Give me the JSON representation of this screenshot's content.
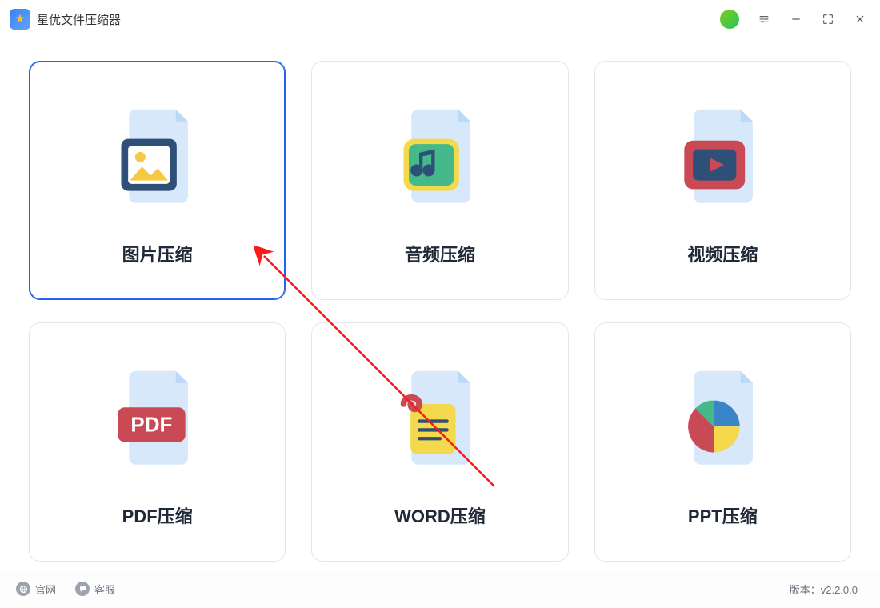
{
  "app": {
    "title": "星优文件压缩器"
  },
  "cards": {
    "image": {
      "label": "图片压缩"
    },
    "audio": {
      "label": "音频压缩"
    },
    "video": {
      "label": "视频压缩"
    },
    "pdf": {
      "label": "PDF压缩"
    },
    "word": {
      "label": "WORD压缩"
    },
    "ppt": {
      "label": "PPT压缩"
    }
  },
  "footer": {
    "site_label": "官网",
    "support_label": "客服",
    "version_prefix": "版本：",
    "version": "v2.2.0.0"
  }
}
